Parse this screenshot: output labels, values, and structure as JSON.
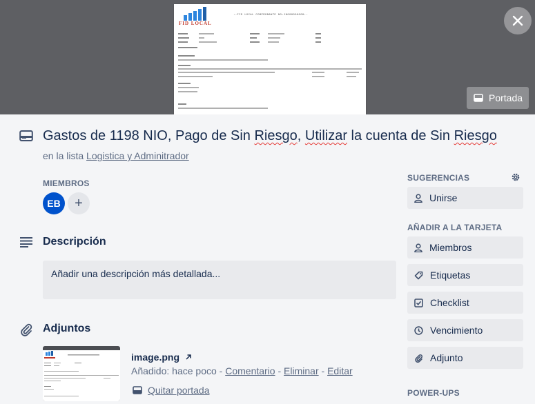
{
  "cover": {
    "document": {
      "logo_text": "FID LOCAL",
      "header_text": ":-FID LOCAL COMPROBANTE NO:JN000000000:-"
    },
    "cover_button_label": "Portada"
  },
  "card": {
    "title_parts": [
      "Gastos de 1198 NIO, Pago de Sin ",
      "Riesgo",
      ", ",
      "Utilizar",
      " la cuenta de Sin ",
      "Riesgo"
    ],
    "list_prefix": "en la lista ",
    "list_name": "Logistica y Adminitrador"
  },
  "members": {
    "label": "MIEMBROS",
    "avatar_initials": "EB",
    "add_symbol": "+"
  },
  "description": {
    "title": "Descripción",
    "placeholder": "Añadir una descripción más detallada..."
  },
  "attachments": {
    "title": "Adjuntos",
    "items": [
      {
        "name": "image.png",
        "added_label": "Añadido: hace poco",
        "sep": " - ",
        "actions": [
          "Comentario",
          "Eliminar",
          "Editar"
        ],
        "remove_cover_label": "Quitar portada"
      }
    ]
  },
  "sidebar": {
    "suggestions_label": "SUGERENCIAS",
    "join_label": "Unirse",
    "add_to_card_label": "AÑADIR A LA TARJETA",
    "add_items": [
      "Miembros",
      "Etiquetas",
      "Checklist",
      "Vencimiento",
      "Adjunto"
    ],
    "powerups_label": "POWER-UPS"
  },
  "colors": {
    "avatar": "#0052cc",
    "cover_bg": "#5e5f63",
    "page_bg": "#f4f5f7"
  },
  "icons": [
    "card-icon",
    "description-icon",
    "paperclip-icon",
    "close-icon",
    "cover-icon",
    "gear-icon",
    "person-icon",
    "tag-icon",
    "checklist-icon",
    "clock-icon",
    "external-link-icon"
  ]
}
